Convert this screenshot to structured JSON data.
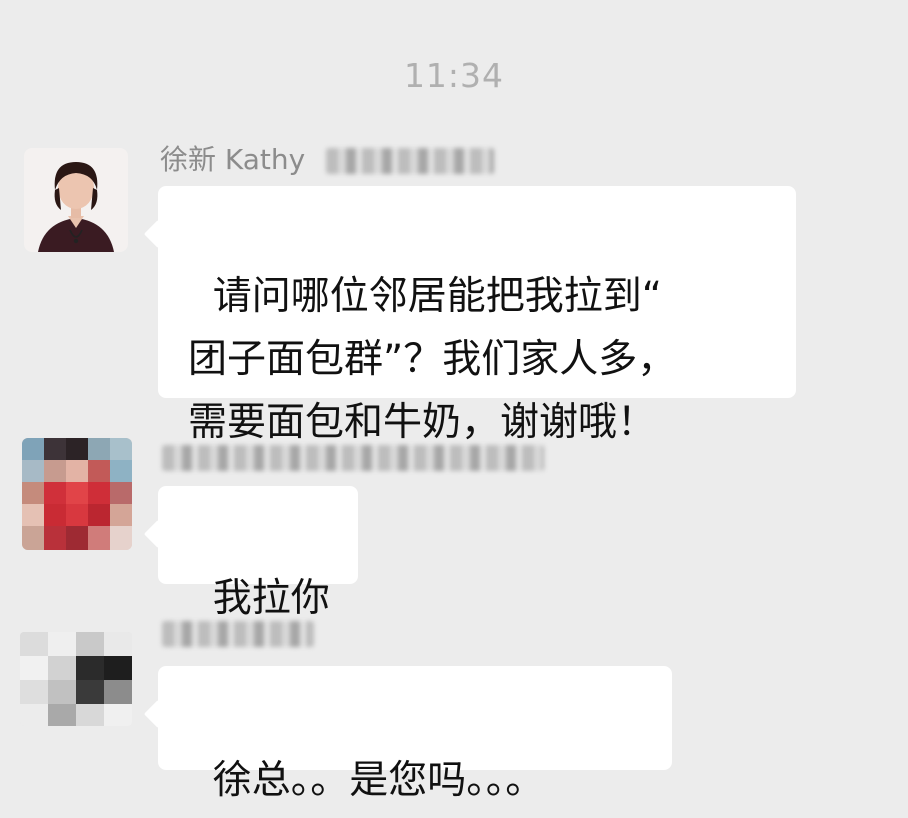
{
  "timestamp": "11:34",
  "messages": [
    {
      "sender": "徐新 Kathy",
      "text": "请问哪位邻居能把我拉到“\n团子面包群”？我们家人多，\n需要面包和牛奶，谢谢哦！"
    },
    {
      "sender": "",
      "text": "我拉你"
    },
    {
      "sender": "",
      "text": "徐总。。是您吗。。。"
    }
  ]
}
